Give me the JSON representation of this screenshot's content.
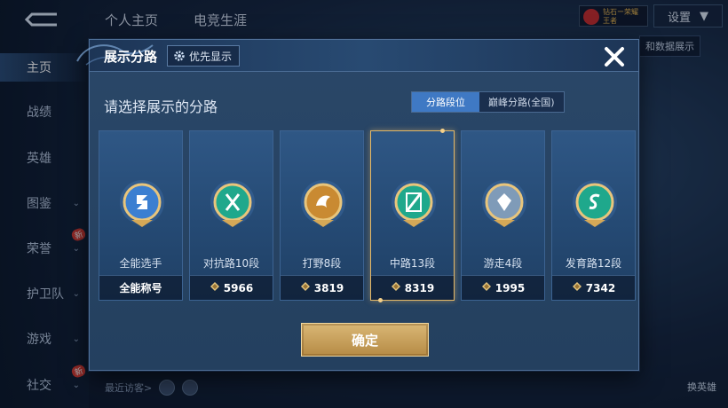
{
  "background": {
    "top_tabs": [
      "个人主页",
      "电竞生涯"
    ],
    "settings_label": "设置",
    "vip_text": "钻石ー荣耀王者",
    "right_pill": "和数据展示",
    "nav": [
      {
        "label": "主页",
        "active": true
      },
      {
        "label": "战绩"
      },
      {
        "label": "英雄"
      },
      {
        "label": "图鉴",
        "chevron": true
      },
      {
        "label": "荣誉",
        "chevron": true,
        "badge": "新"
      },
      {
        "label": "护卫队",
        "chevron": true
      },
      {
        "label": "游戏",
        "chevron": true
      },
      {
        "label": "社交",
        "chevron": true,
        "badge": "新"
      }
    ],
    "visitors_label": "最近访客>",
    "bottom_right_label": "换英雄"
  },
  "modal": {
    "title": "展示分路",
    "priority_label": "优先显示",
    "subtitle": "请选择展示的分路",
    "segment_tabs": [
      "分路段位",
      "巅峰分路(全国)"
    ],
    "active_segment": 0,
    "confirm_label": "确定",
    "cards": [
      {
        "lane": "全能选手",
        "footer": "全能称号",
        "points": false,
        "emblem": "all-round-emblem-icon",
        "color": "#3b7fd1"
      },
      {
        "lane": "对抗路10段",
        "footer": "5966",
        "points": true,
        "emblem": "clash-lane-emblem-icon",
        "color": "#1fa88c"
      },
      {
        "lane": "打野8段",
        "footer": "3819",
        "points": true,
        "emblem": "jungle-emblem-icon",
        "color": "#c98a32"
      },
      {
        "lane": "中路13段",
        "footer": "8319",
        "points": true,
        "emblem": "mid-lane-emblem-icon",
        "color": "#1fa88c",
        "selected": true
      },
      {
        "lane": "游走4段",
        "footer": "1995",
        "points": true,
        "emblem": "roam-emblem-icon",
        "color": "#7f9bb8"
      },
      {
        "lane": "发育路12段",
        "footer": "7342",
        "points": true,
        "emblem": "farm-lane-emblem-icon",
        "color": "#1fa88c"
      }
    ]
  },
  "colors": {
    "accent_gold": "#e3b868",
    "tab_active": "#3f79c4",
    "emerald": "#1fa88c"
  }
}
